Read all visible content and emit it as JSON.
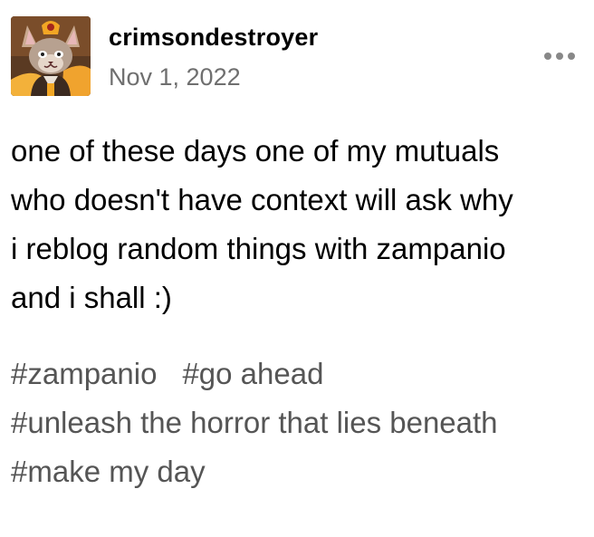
{
  "post": {
    "author": {
      "username": "crimsondestroyer",
      "avatar_icon": "cat-character-avatar"
    },
    "date": "Nov 1, 2022",
    "more_icon": "more-options-icon",
    "body_lines": [
      "one of these days one of my mutuals",
      "who doesn't have context will ask why",
      "i reblog random things with zampanio",
      "and i shall :)"
    ],
    "tags": [
      "#zampanio",
      "#go ahead",
      "#unleash the horror that lies beneath",
      "#make my day"
    ]
  },
  "colors": {
    "text": "#000000",
    "muted": "#6f6f6f",
    "tag": "#555555",
    "background": "#ffffff"
  }
}
